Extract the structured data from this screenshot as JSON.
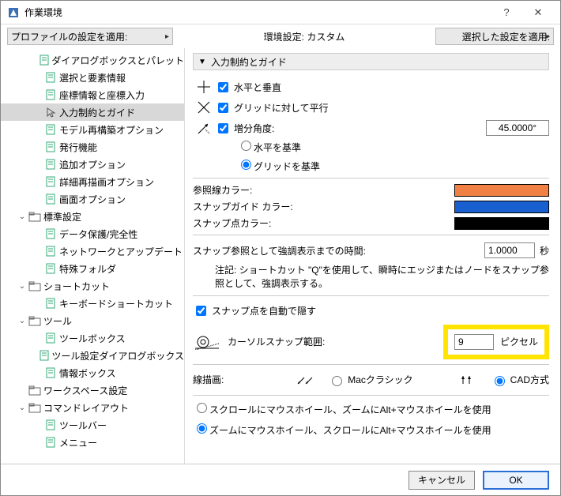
{
  "titlebar": {
    "title": "作業環境"
  },
  "topbar": {
    "profile_combo": "プロファイルの設定を適用:",
    "center": "環境設定: カスタム",
    "apply_combo": "選択した設定を適用:"
  },
  "tree": [
    {
      "ind": 2,
      "label": "ダイアログボックスとパレット",
      "tw": ""
    },
    {
      "ind": 2,
      "label": "選択と要素情報",
      "tw": ""
    },
    {
      "ind": 2,
      "label": "座標情報と座標入力",
      "tw": ""
    },
    {
      "ind": 2,
      "label": "入力制約とガイド",
      "tw": "",
      "sel": true
    },
    {
      "ind": 2,
      "label": "モデル再構築オプション",
      "tw": ""
    },
    {
      "ind": 2,
      "label": "発行機能",
      "tw": ""
    },
    {
      "ind": 2,
      "label": "追加オプション",
      "tw": ""
    },
    {
      "ind": 2,
      "label": "詳細再描画オプション",
      "tw": ""
    },
    {
      "ind": 2,
      "label": "画面オプション",
      "tw": ""
    },
    {
      "ind": 1,
      "label": "標準設定",
      "tw": "v"
    },
    {
      "ind": 2,
      "label": "データ保護/完全性",
      "tw": ""
    },
    {
      "ind": 2,
      "label": "ネットワークとアップデート",
      "tw": ""
    },
    {
      "ind": 2,
      "label": "特殊フォルダ",
      "tw": ""
    },
    {
      "ind": 1,
      "label": "ショートカット",
      "tw": "v"
    },
    {
      "ind": 2,
      "label": "キーボードショートカット",
      "tw": ""
    },
    {
      "ind": 1,
      "label": "ツール",
      "tw": "v"
    },
    {
      "ind": 2,
      "label": "ツールボックス",
      "tw": ""
    },
    {
      "ind": 2,
      "label": "ツール設定ダイアログボックス",
      "tw": ""
    },
    {
      "ind": 2,
      "label": "情報ボックス",
      "tw": ""
    },
    {
      "ind": 1,
      "label": "ワークスペース設定",
      "tw": ""
    },
    {
      "ind": 1,
      "label": "コマンドレイアウト",
      "tw": "v"
    },
    {
      "ind": 2,
      "label": "ツールバー",
      "tw": ""
    },
    {
      "ind": 2,
      "label": "メニュー",
      "tw": ""
    }
  ],
  "section": {
    "title": "入力制約とガイド"
  },
  "chk": {
    "horiz_vert": "水平と垂直",
    "grid_parallel": "グリッドに対して平行",
    "incr_angle": "増分角度:",
    "auto_hide_snap": "スナップ点を自動で隠す"
  },
  "radio": {
    "base_h": "水平を基準",
    "base_g": "グリッドを基準",
    "mac": "Macクラシック",
    "cad": "CAD方式",
    "scroll_first": "スクロールにマウスホイール、ズームにAlt+マウスホイールを使用",
    "zoom_first": "ズームにマウスホイール、スクロールにAlt+マウスホイールを使用"
  },
  "fields": {
    "angle": "45.0000°",
    "time": "1.0000",
    "time_unit": "秒",
    "snap_range": "9",
    "snap_unit": "ピクセル"
  },
  "labels": {
    "ref_color": "参照線カラー:",
    "snap_guide_color": "スナップガイド カラー:",
    "snap_point_color": "スナップ点カラー:",
    "snap_time": "スナップ参照として強調表示までの時間:",
    "note": "注記: ショートカット \"Q\"を使用して、瞬時にエッジまたはノードをスナップ参照として、強調表示する。",
    "cursor_range": "カーソルスナップ範囲:",
    "line_draw": "線描画:"
  },
  "colors": {
    "ref": "#f08044",
    "guide": "#1a5fd0",
    "point": "#000000"
  },
  "footer": {
    "cancel": "キャンセル",
    "ok": "OK"
  }
}
